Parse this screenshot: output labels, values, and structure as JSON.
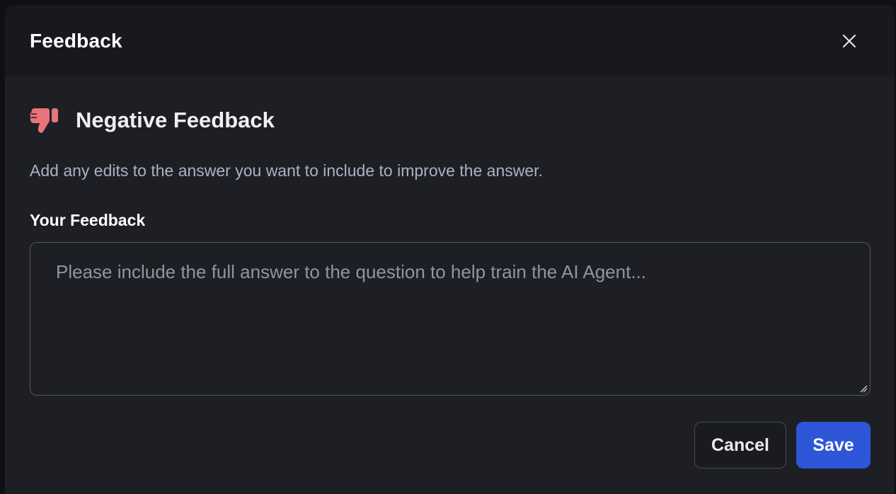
{
  "dialog": {
    "title": "Feedback",
    "close_icon": "close-icon"
  },
  "section": {
    "icon": "thumbs-down-icon",
    "icon_color": "#e8737a",
    "title": "Negative Feedback",
    "description": "Add any edits to the answer you want to include to improve the answer."
  },
  "feedback_field": {
    "label": "Your Feedback",
    "value": "",
    "placeholder": "Please include the full answer to the question to help train the AI Agent..."
  },
  "actions": {
    "cancel_label": "Cancel",
    "save_label": "Save",
    "save_color": "#2e56d8"
  }
}
